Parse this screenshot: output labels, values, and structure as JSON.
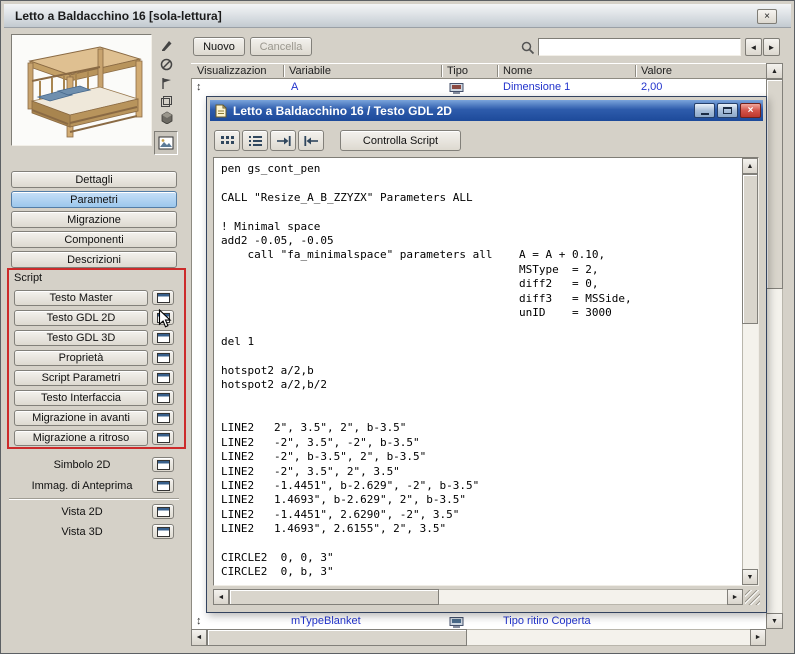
{
  "window": {
    "title": "Letto a Baldacchino 16 [sola-lettura]"
  },
  "top_toolbar": {
    "nuovo": "Nuovo",
    "cancella": "Cancella",
    "search_value": ""
  },
  "param_table": {
    "headers": {
      "visualizzazione": "Visualizzazion",
      "variabile": "Variabile",
      "tipo": "Tipo",
      "nome": "Nome",
      "valore": "Valore"
    },
    "row1": {
      "variabile": "A",
      "nome": "Dimensione 1",
      "valore": "2,00"
    },
    "row2": {
      "variabile": "mTypeBlanket",
      "nome": "Tipo ritiro Coperta"
    }
  },
  "sidebar": {
    "nav": [
      "Dettagli",
      "Parametri",
      "Migrazione",
      "Componenti",
      "Descrizioni"
    ],
    "script_section": "Script",
    "script_items": [
      "Testo Master",
      "Testo GDL 2D",
      "Testo GDL 3D",
      "Proprietà",
      "Script Parametri",
      "Testo Interfaccia",
      "Migrazione in avanti",
      "Migrazione a ritroso"
    ],
    "view_items": [
      "Simbolo 2D",
      "Immag. di Anteprima",
      "Vista 2D",
      "Vista 3D"
    ]
  },
  "editor_window": {
    "title": "Letto a Baldacchino 16 / Testo GDL 2D",
    "check_button": "Controlla Script",
    "code": "pen gs_cont_pen\n\nCALL \"Resize_A_B_ZZYZX\" Parameters ALL\n\n! Minimal space\nadd2 -0.05, -0.05\n    call \"fa_minimalspace\" parameters all    A = A + 0.10,\n                                             MSType  = 2,\n                                             diff2   = 0,\n                                             diff3   = MSSide,\n                                             unID    = 3000\n\ndel 1\n\nhotspot2 a/2,b\nhotspot2 a/2,b/2\n\n\nLINE2   2\", 3.5\", 2\", b-3.5\"\nLINE2   -2\", 3.5\", -2\", b-3.5\"\nLINE2   -2\", b-3.5\", 2\", b-3.5\"\nLINE2   -2\", 3.5\", 2\", 3.5\"\nLINE2   -1.4451\", b-2.629\", -2\", b-3.5\"\nLINE2   1.4693\", b-2.629\", 2\", b-3.5\"\nLINE2   -1.4451\", 2.6290\", -2\", 3.5\"\nLINE2   1.4693\", 2.6155\", 2\", 3.5\"\n\nCIRCLE2  0, 0, 3\"\nCIRCLE2  0, b, 3\""
  },
  "icons": {
    "close": "×",
    "find_prev": "◄",
    "find_next": "►",
    "row_handle": "↕",
    "up": "▲",
    "down": "▼",
    "left": "◄",
    "right": "►"
  },
  "colors": {
    "titlebar_blue": "#2e5cac",
    "selected_blue": "#9cc7ec",
    "outline_red": "#cc2b2b",
    "link_blue": "#2233cc",
    "close_red": "#d4544a"
  }
}
